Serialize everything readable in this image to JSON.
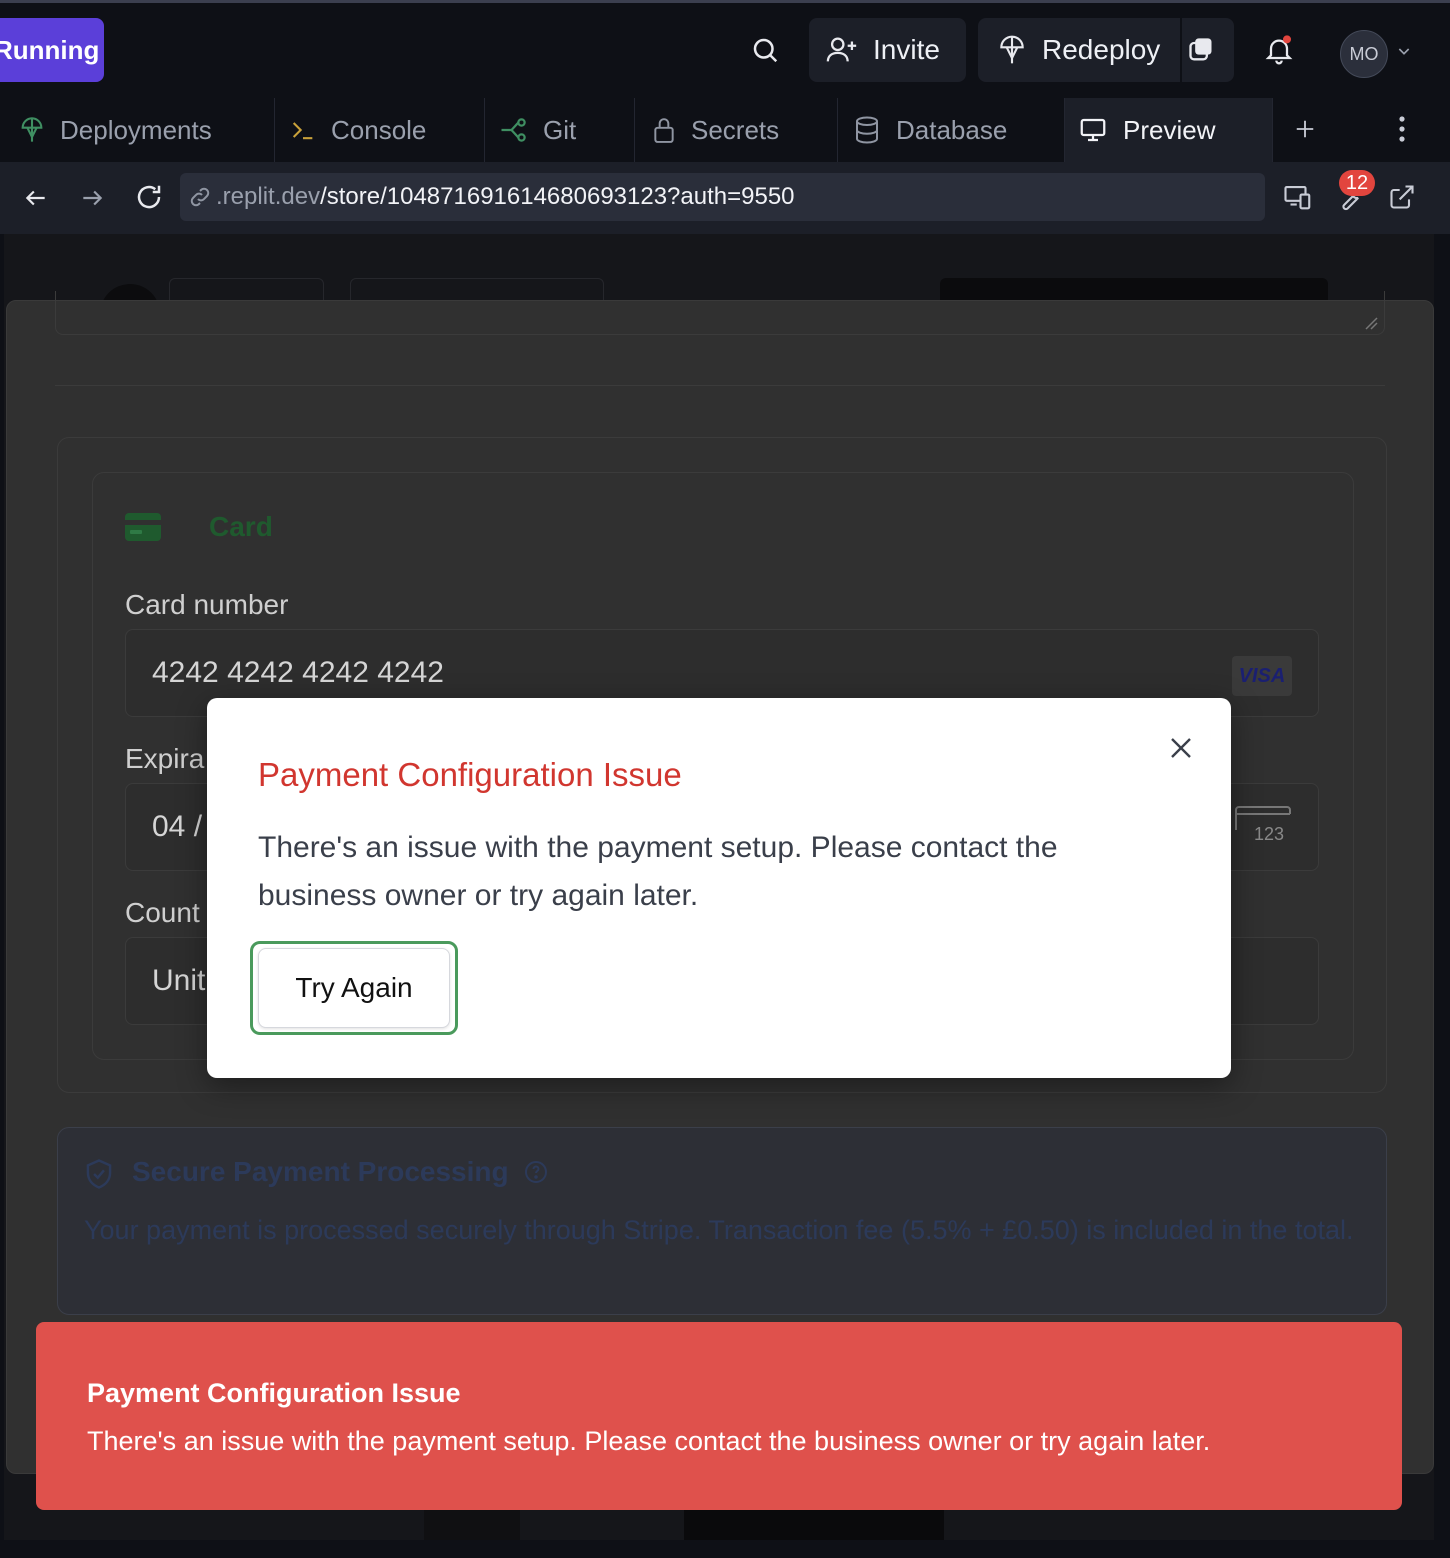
{
  "topbar": {
    "run_label": "Running",
    "invite_label": "Invite",
    "redeploy_label": "Redeploy",
    "avatar_initials": "MO"
  },
  "tabs": [
    {
      "label": "Deployments",
      "icon": "deployments-icon"
    },
    {
      "label": "Console",
      "icon": "console-icon"
    },
    {
      "label": "Git",
      "icon": "git-icon"
    },
    {
      "label": "Secrets",
      "icon": "lock-icon"
    },
    {
      "label": "Database",
      "icon": "database-icon"
    },
    {
      "label": "Preview",
      "icon": "monitor-icon"
    }
  ],
  "urlbar": {
    "url_host": ".replit.dev",
    "url_path": "/store/104871691614680693123?auth=9550",
    "devtools_badge": "12"
  },
  "checkout": {
    "card_tab_label": "Card",
    "card_number_label": "Card number",
    "card_number_value": "4242 4242 4242 4242",
    "card_brand": "VISA",
    "expiration_label_partial": "Expira",
    "expiration_value_partial": "04 /",
    "cvc_hint": "123",
    "country_label_partial": "Count",
    "country_value_partial": "Unit",
    "secure_title": "Secure Payment Processing",
    "secure_body": "Your payment is processed securely through Stripe. Transaction fee (5.5% + £0.50) is included in the total."
  },
  "modal": {
    "title": "Payment Configuration Issue",
    "body": "There's an issue with the payment setup. Please contact the business owner or try again later.",
    "button_label": "Try Again"
  },
  "toast": {
    "title": "Payment Configuration Issue",
    "body": "There's an issue with the payment setup. Please contact the business owner or try again later."
  },
  "colors": {
    "accent_run": "#5b3fd9",
    "error_title": "#d1362f",
    "toast_bg": "#df514c",
    "focus_ring": "#4a9a5c"
  }
}
